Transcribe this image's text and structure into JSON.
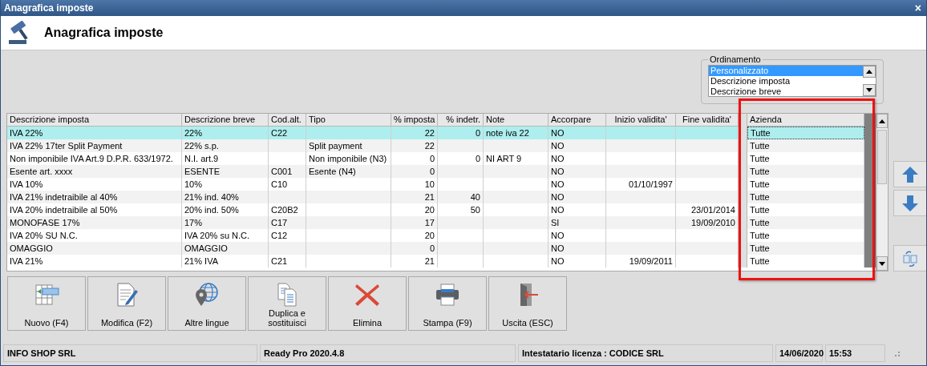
{
  "window": {
    "title": "Anagrafica imposte",
    "close": "×"
  },
  "header": {
    "title": "Anagrafica imposte"
  },
  "ordering": {
    "label": "Ordinamento",
    "items": [
      {
        "label": "Personalizzato",
        "selected": true
      },
      {
        "label": "Descrizione imposta",
        "selected": false
      },
      {
        "label": "Descrizione breve",
        "selected": false
      }
    ]
  },
  "table": {
    "columns": [
      {
        "label": "Descrizione imposta",
        "kind": "text",
        "highlighted": false
      },
      {
        "label": "Descrizione breve",
        "kind": "text",
        "highlighted": false
      },
      {
        "label": "Cod.alt.",
        "kind": "text",
        "highlighted": false
      },
      {
        "label": "Tipo",
        "kind": "text",
        "highlighted": false
      },
      {
        "label": "% imposta",
        "kind": "number",
        "highlighted": false
      },
      {
        "label": "% indetr.",
        "kind": "number",
        "highlighted": false
      },
      {
        "label": "Note",
        "kind": "text",
        "highlighted": false
      },
      {
        "label": "Accorpare",
        "kind": "text",
        "highlighted": false
      },
      {
        "label": "Inizio validita'",
        "kind": "date",
        "highlighted": false
      },
      {
        "label": "Fine validita'",
        "kind": "date",
        "highlighted": false
      },
      {
        "label": "Azienda",
        "kind": "text",
        "highlighted": true
      }
    ],
    "rows": [
      {
        "selected": true,
        "cells": [
          "IVA 22%",
          "22%",
          "C22",
          "",
          "22",
          "0",
          "note iva 22",
          "NO",
          "",
          "",
          "Tutte"
        ]
      },
      {
        "selected": false,
        "cells": [
          "IVA 22% 17ter Split Payment",
          "22% s.p.",
          "",
          "Split payment",
          "22",
          "",
          "",
          "NO",
          "",
          "",
          "Tutte"
        ]
      },
      {
        "selected": false,
        "cells": [
          "Non imponibile IVA Art.9 D.P.R. 633/1972.",
          "N.I. art.9",
          "",
          "Non imponibile (N3)",
          "0",
          "0",
          "NI ART 9",
          "NO",
          "",
          "",
          "Tutte"
        ]
      },
      {
        "selected": false,
        "cells": [
          "Esente art. xxxx",
          "ESENTE",
          "C001",
          "Esente (N4)",
          "0",
          "",
          "",
          "NO",
          "",
          "",
          "Tutte"
        ]
      },
      {
        "selected": false,
        "cells": [
          "IVA 10%",
          "10%",
          "C10",
          "",
          "10",
          "",
          "",
          "NO",
          "01/10/1997",
          "",
          "Tutte"
        ]
      },
      {
        "selected": false,
        "cells": [
          "IVA 21% indetraibile al 40%",
          "21% ind. 40%",
          "",
          "",
          "21",
          "40",
          "",
          "NO",
          "",
          "",
          "Tutte"
        ]
      },
      {
        "selected": false,
        "cells": [
          "IVA 20% indetraibile al 50%",
          "20% ind. 50%",
          "C20B2",
          "",
          "20",
          "50",
          "",
          "NO",
          "",
          "23/01/2014",
          "Tutte"
        ]
      },
      {
        "selected": false,
        "cells": [
          "MONOFASE 17%",
          "17%",
          "C17",
          "",
          "17",
          "",
          "",
          "SI",
          "",
          "19/09/2010",
          "Tutte"
        ]
      },
      {
        "selected": false,
        "cells": [
          "IVA 20% SU N.C.",
          "IVA 20% su N.C.",
          "C12",
          "",
          "20",
          "",
          "",
          "NO",
          "",
          "",
          "Tutte"
        ]
      },
      {
        "selected": false,
        "cells": [
          "OMAGGIO",
          "OMAGGIO",
          "",
          "",
          "0",
          "",
          "",
          "NO",
          "",
          "",
          "Tutte"
        ]
      },
      {
        "selected": false,
        "cells": [
          "IVA 21%",
          "21% IVA",
          "C21",
          "",
          "21",
          "",
          "",
          "NO",
          "19/09/2011",
          "",
          "Tutte"
        ]
      }
    ]
  },
  "side_buttons": [
    {
      "kind": "up"
    },
    {
      "kind": "down"
    },
    {
      "kind": "swap"
    }
  ],
  "buttons": [
    {
      "label": "Nuovo (F4)",
      "kind": "new"
    },
    {
      "label": "Modifica (F2)",
      "kind": "edit"
    },
    {
      "label": "Altre lingue",
      "kind": "globe"
    },
    {
      "label": "Duplica e sostituisci",
      "kind": "duplicate"
    },
    {
      "label": "Elimina",
      "kind": "delete"
    },
    {
      "label": "Stampa (F9)",
      "kind": "print"
    },
    {
      "label": "Uscita (ESC)",
      "kind": "exit"
    }
  ],
  "status_bar": [
    "INFO SHOP SRL",
    "Ready Pro 2020.4.8",
    "Intestatario licenza : CODICE SRL",
    "14/06/2020",
    "15:53"
  ]
}
